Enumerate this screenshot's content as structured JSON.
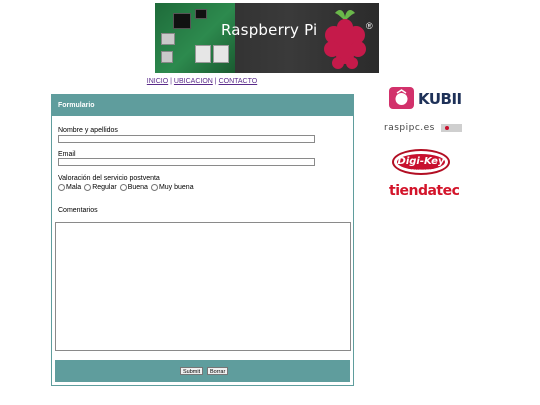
{
  "header": {
    "banner_text": "Raspberry Pi",
    "registered_mark": "®"
  },
  "nav": {
    "items": [
      {
        "label": "INICIO"
      },
      {
        "label": "UBICACION"
      },
      {
        "label": "CONTACTO"
      }
    ],
    "separator": "|"
  },
  "form": {
    "title": "Formulario",
    "name_label": "Nombre y apellidos",
    "name_value": "",
    "email_label": "Email",
    "email_value": "",
    "rating_label": "Valoración del servicio postventa",
    "rating_options": [
      {
        "label": "Mala"
      },
      {
        "label": "Regular"
      },
      {
        "label": "Buena"
      },
      {
        "label": "Muy buena"
      }
    ],
    "comments_label": "Comentarios",
    "comments_value": "",
    "submit_label": "Submit",
    "reset_label": "Borrar"
  },
  "sponsors": {
    "kubii": "KUBII",
    "raspipc": "raspipc.es",
    "digikey": "Digi-Key",
    "digikey_sub": "ELECTRONICS",
    "tiendatec": "tiendatec"
  },
  "colors": {
    "panel_teal": "#5f9d9d",
    "nav_link": "#5a2a8a",
    "kubii_pink": "#d2316b",
    "digikey_red": "#c8102e",
    "tiendatec_red": "#d3142a"
  }
}
